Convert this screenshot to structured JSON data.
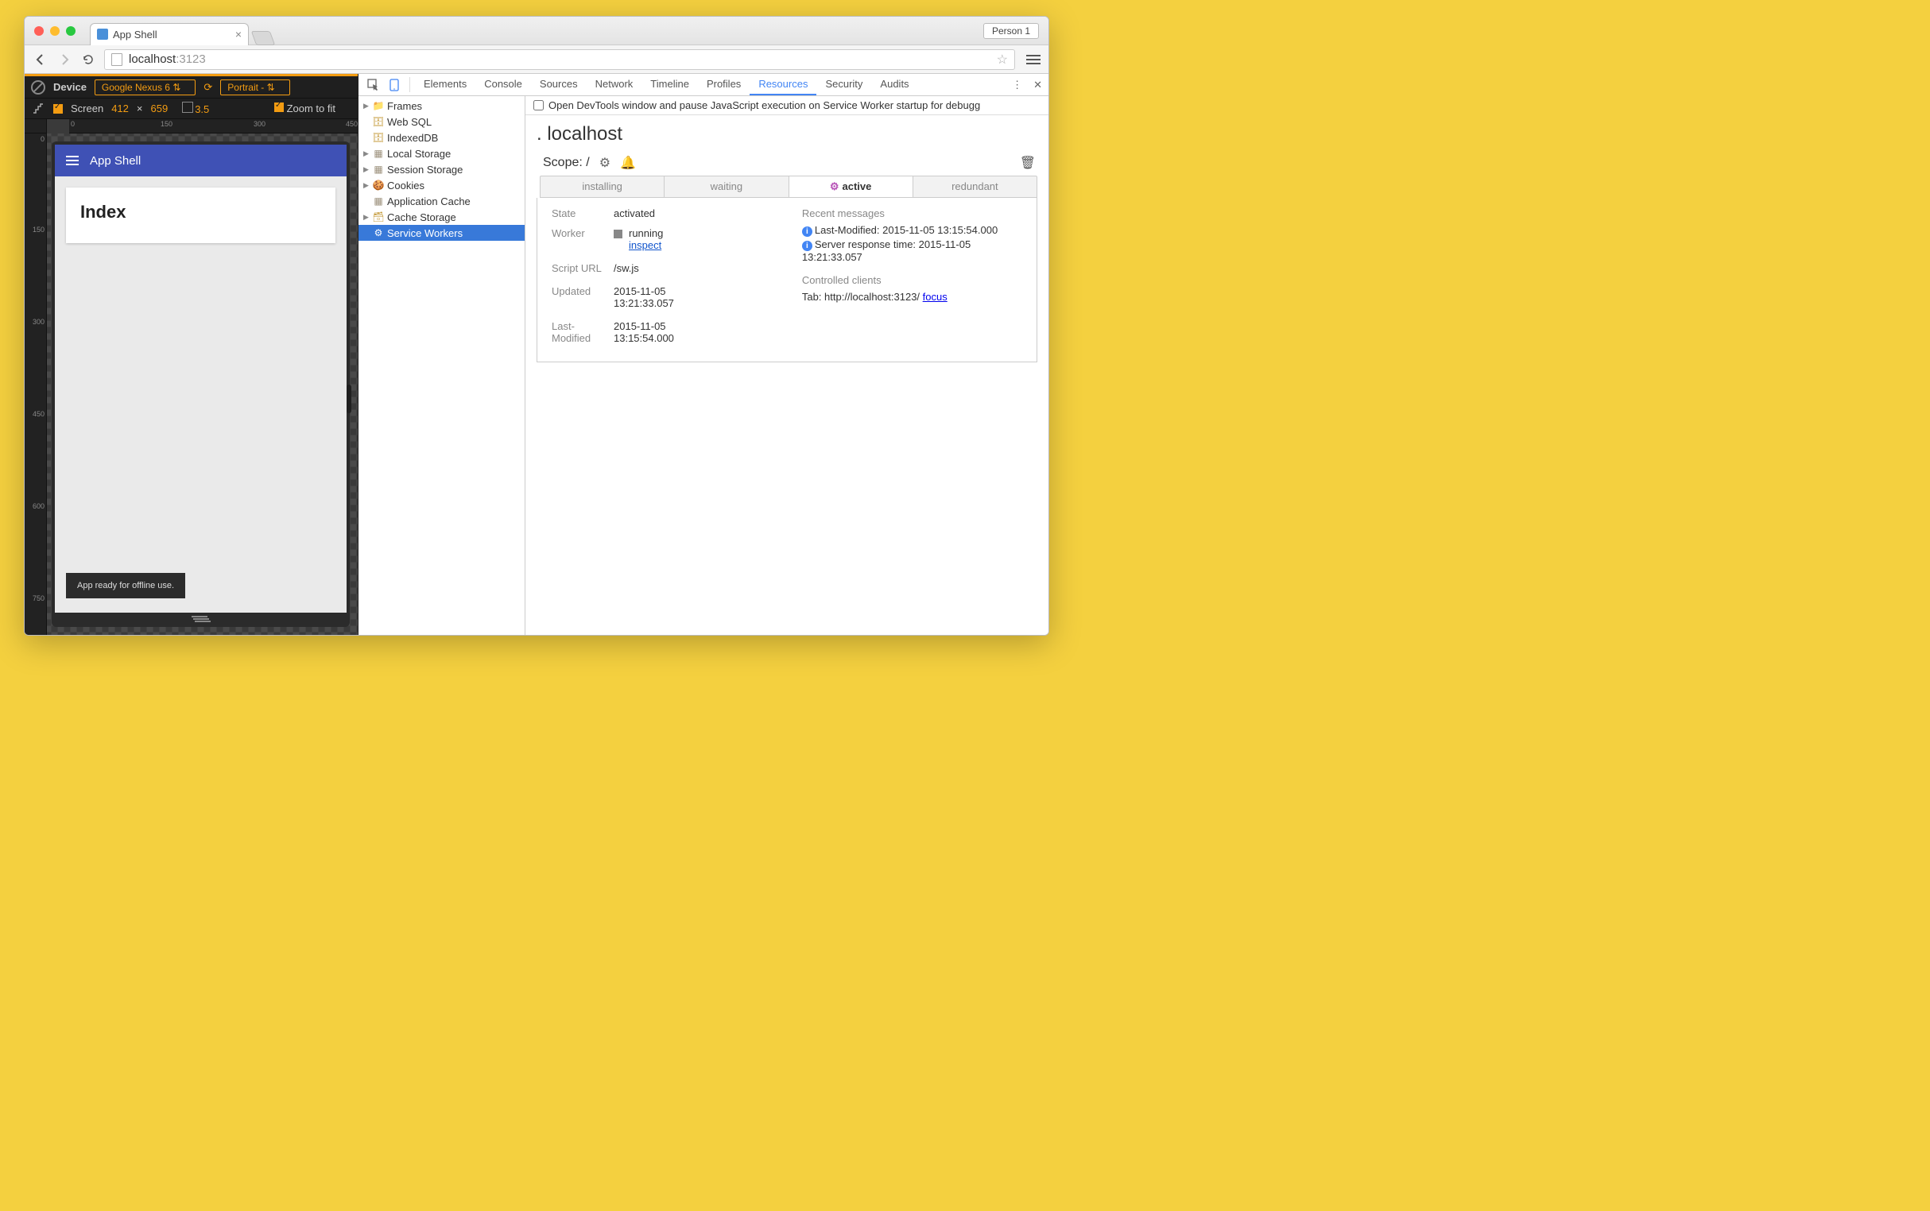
{
  "browser": {
    "tab_title": "App Shell",
    "person_label": "Person 1",
    "url_host": "localhost",
    "url_port": ":3123"
  },
  "device_mode": {
    "device_label": "Device",
    "device_name": "Google Nexus 6",
    "orientation": "Portrait -",
    "screen_label": "Screen",
    "width": "412",
    "times": "×",
    "height": "659",
    "dpr": "3.5",
    "zoom_label": "Zoom to fit",
    "ruler_h": [
      "0",
      "150",
      "300",
      "450"
    ],
    "ruler_v": [
      "0",
      "150",
      "300",
      "450",
      "600",
      "750"
    ]
  },
  "app": {
    "title": "App Shell",
    "card_title": "Index",
    "toast": "App ready for offline use."
  },
  "devtools": {
    "tabs": [
      "Elements",
      "Console",
      "Sources",
      "Network",
      "Timeline",
      "Profiles",
      "Resources",
      "Security",
      "Audits"
    ],
    "active_tab": "Resources",
    "resources_tree": [
      {
        "label": "Frames",
        "icon": "folder",
        "expandable": true
      },
      {
        "label": "Web SQL",
        "icon": "db",
        "expandable": false
      },
      {
        "label": "IndexedDB",
        "icon": "db",
        "expandable": false
      },
      {
        "label": "Local Storage",
        "icon": "grid",
        "expandable": true
      },
      {
        "label": "Session Storage",
        "icon": "grid",
        "expandable": true
      },
      {
        "label": "Cookies",
        "icon": "cookie",
        "expandable": true
      },
      {
        "label": "Application Cache",
        "icon": "grid",
        "expandable": false
      },
      {
        "label": "Cache Storage",
        "icon": "stack",
        "expandable": true
      },
      {
        "label": "Service Workers",
        "icon": "gear",
        "expandable": false,
        "selected": true
      }
    ],
    "sw": {
      "option_label": "Open DevTools window and pause JavaScript execution on Service Worker startup for debugg",
      "origin": "localhost",
      "scope_label": "Scope: /",
      "status_tabs": [
        "installing",
        "waiting",
        "active",
        "redundant"
      ],
      "active_status": "active",
      "state_k": "State",
      "state_v": "activated",
      "worker_k": "Worker",
      "worker_status": "running",
      "worker_inspect": "inspect",
      "script_k": "Script URL",
      "script_v": "/sw.js",
      "updated_k": "Updated",
      "updated_v1": "2015-11-05",
      "updated_v2": "13:21:33.057",
      "lastmod_k": "Last-Modified",
      "lastmod_v1": "2015-11-05",
      "lastmod_v2": "13:15:54.000",
      "recent_hdr": "Recent messages",
      "msg1": "Last-Modified: 2015-11-05 13:15:54.000",
      "msg2": "Server response time: 2015-11-05 13:21:33.057",
      "clients_hdr": "Controlled clients",
      "client_prefix": "Tab: http://localhost:3123/ ",
      "client_focus": "focus"
    }
  }
}
